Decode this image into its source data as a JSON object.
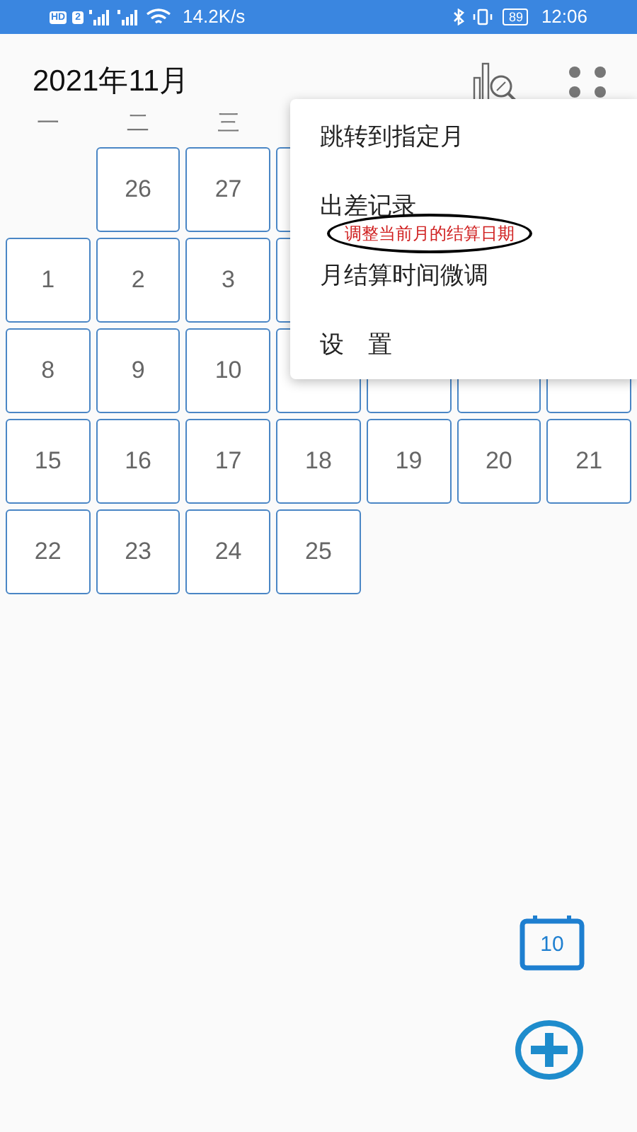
{
  "status_bar": {
    "hd": "HD",
    "sim": "2",
    "speed": "14.2K/s",
    "battery": "89",
    "time": "12:06"
  },
  "header": {
    "title": "2021年11月"
  },
  "weekdays": [
    "一",
    "二",
    "三"
  ],
  "weeks": [
    [
      {
        "kind": "blank"
      },
      {
        "kind": "day",
        "day": "26"
      },
      {
        "kind": "day",
        "day": "27"
      },
      {
        "kind": "covered"
      },
      {
        "kind": "hidden"
      },
      {
        "kind": "hidden"
      },
      {
        "kind": "hidden"
      }
    ],
    [
      {
        "kind": "day",
        "day": "1"
      },
      {
        "kind": "day",
        "day": "2"
      },
      {
        "kind": "day",
        "day": "3"
      },
      {
        "kind": "covered"
      },
      {
        "kind": "hidden"
      },
      {
        "kind": "hidden"
      },
      {
        "kind": "hidden"
      }
    ],
    [
      {
        "kind": "day",
        "day": "8"
      },
      {
        "kind": "day",
        "day": "9"
      },
      {
        "kind": "day",
        "day": "10"
      },
      {
        "kind": "covered"
      },
      {
        "kind": "covered"
      },
      {
        "kind": "covered"
      },
      {
        "kind": "covered"
      }
    ],
    [
      {
        "kind": "day",
        "day": "15"
      },
      {
        "kind": "day",
        "day": "16"
      },
      {
        "kind": "day",
        "day": "17"
      },
      {
        "kind": "day",
        "day": "18"
      },
      {
        "kind": "day",
        "day": "19"
      },
      {
        "kind": "day",
        "day": "20"
      },
      {
        "kind": "day",
        "day": "21"
      }
    ],
    [
      {
        "kind": "day",
        "day": "22"
      },
      {
        "kind": "day",
        "day": "23"
      },
      {
        "kind": "day",
        "day": "24"
      },
      {
        "kind": "day",
        "day": "25"
      }
    ]
  ],
  "menu": {
    "items": [
      "跳转到指定月",
      "出差记录",
      "月结算时间微调",
      "设　置"
    ],
    "annotation": "调整当前月的结算日期"
  },
  "today_button": {
    "day": "10"
  }
}
